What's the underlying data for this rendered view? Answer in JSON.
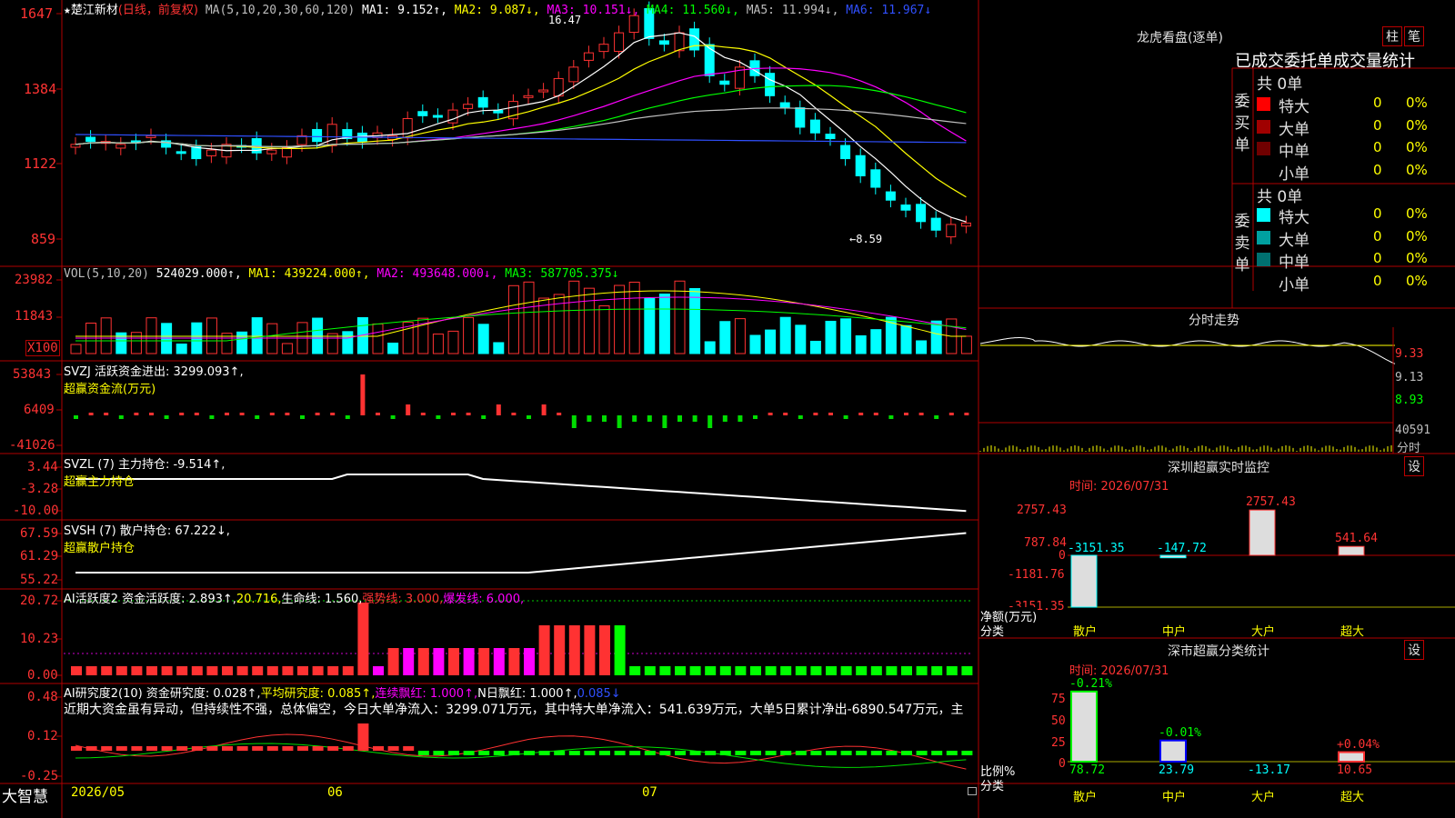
{
  "stock": {
    "star": "★",
    "name": "楚江新材",
    "period": "(日线，前复权)"
  },
  "kline": {
    "ma_label": "MA(5,10,20,30,60,120)",
    "ma1": "MA1: 9.152↑,",
    "ma2": "MA2: 9.087↓,",
    "ma3": "MA3: 10.151↓,",
    "ma4": "MA4: 11.560↓,",
    "ma5": "MA5: 11.994↓,",
    "ma6": "MA6: 11.967↓",
    "y_ticks": [
      "1647",
      "1384",
      "1122",
      "859"
    ],
    "high_label": "16.47",
    "low_label": "←8.59"
  },
  "volume": {
    "label": "VOL(5,10,20)",
    "value": "524029.000↑,",
    "ma1": "MA1: 439224.000↑,",
    "ma2": "MA2: 493648.000↓,",
    "ma3": "MA3: 587705.375↓",
    "y_ticks": [
      "23982",
      "11843",
      "X100"
    ]
  },
  "svzj": {
    "label": "SVZJ  活跃资金进出: 3299.093↑,",
    "sub": "超赢资金流(万元)",
    "y_ticks": [
      "53843",
      "6409",
      "-41026"
    ]
  },
  "svzl": {
    "label": "SVZL (7) 主力持仓: -9.514↑,",
    "sub": "超赢主力持仓",
    "y_ticks": [
      "3.44",
      "-3.28",
      "-10.00"
    ]
  },
  "svsh": {
    "label": "SVSH (7) 散户持仓: 67.222↓,",
    "sub": "超赢散户持仓",
    "y_ticks": [
      "67.59",
      "61.29",
      "55.22"
    ]
  },
  "ai_active": {
    "label": "AI活跃度2 资金活跃度: 2.893↑,",
    "v2": "20.716,",
    "life": "生命线: 1.560,",
    "strong": "强势线: 3.000,",
    "burst": "爆发线: 6.000,",
    "y_ticks": [
      "20.72",
      "10.23",
      "0.00"
    ]
  },
  "ai_research": {
    "label": "AI研究度2(10) 资金研究度: 0.028↑,",
    "avg": "平均研究度: 0.085↑,",
    "lianxu": "连续飘红: 1.000↑,",
    "nday": "N日飘红: 1.000↑,",
    "last": "0.085↓",
    "comment": "近期大资金虽有异动，但持续性不强，总体偏空，今日大单净流入：3299.071万元，其中特大单净流入：541.639万元，大单5日累计净出-6890.547万元，主",
    "y_ticks": [
      "0.48",
      "0.12",
      "-0.25"
    ]
  },
  "footer": {
    "brand": "大智慧",
    "dates": [
      "2026/05",
      "06",
      "07"
    ]
  },
  "dragon": {
    "title": "龙虎看盘(逐单)",
    "btn1": "柱",
    "btn2": "笔",
    "subtitle": "已成交委托单成交量统计",
    "buy": {
      "side": "委买单",
      "total": "共 0单",
      "rows": [
        {
          "name": "特大",
          "val": "0",
          "pct": "0%",
          "color": "#ff0000"
        },
        {
          "name": "大单",
          "val": "0",
          "pct": "0%",
          "color": "#a00000"
        },
        {
          "name": "中单",
          "val": "0",
          "pct": "0%",
          "color": "#700000"
        },
        {
          "name": "小单",
          "val": "0",
          "pct": "0%",
          "color": "#000000"
        }
      ]
    },
    "sell": {
      "side": "委卖单",
      "total": "共 0单",
      "rows": [
        {
          "name": "特大",
          "val": "0",
          "pct": "0%",
          "color": "#00ffff"
        },
        {
          "name": "大单",
          "val": "0",
          "pct": "0%",
          "color": "#00a0a0"
        },
        {
          "name": "中单",
          "val": "0",
          "pct": "0%",
          "color": "#007070"
        },
        {
          "name": "小单",
          "val": "0",
          "pct": "0%",
          "color": "#000000"
        }
      ]
    }
  },
  "intraday": {
    "title": "分时走势",
    "y_ticks": [
      "9.33",
      "9.13",
      "8.93"
    ],
    "vol": "40591",
    "vol_unit": "分时"
  },
  "monitor": {
    "title": "深圳超赢实时监控",
    "btn": "设",
    "time": "时间: 2026/07/31",
    "y_ticks": [
      "2757.43",
      "787.84",
      "0",
      "-1181.76",
      "-3151.35"
    ],
    "axis_label1": "净额(万元)",
    "axis_label2": "分类",
    "bars": [
      {
        "cat": "散户",
        "value": "-3151.35"
      },
      {
        "cat": "中户",
        "value": "-147.72"
      },
      {
        "cat": "大户",
        "value": "2757.43"
      },
      {
        "cat": "超大",
        "value": "541.64"
      }
    ]
  },
  "classify": {
    "title": "深市超赢分类统计",
    "btn": "设",
    "time": "时间: 2026/07/31",
    "y_ticks": [
      "75",
      "50",
      "25",
      "0"
    ],
    "axis_label1": "比例%",
    "axis_label2": "分类",
    "bars": [
      {
        "cat": "散户",
        "value": "78.72",
        "chg": "-0.21%"
      },
      {
        "cat": "中户",
        "value": "23.79",
        "chg": "-0.01%"
      },
      {
        "cat": "大户",
        "value": "-13.17",
        "chg": ""
      },
      {
        "cat": "超大",
        "value": "10.65",
        "chg": "+0.04%"
      }
    ]
  },
  "colors": {
    "up": "#ff3232",
    "down": "#00ffff",
    "ma1": "#ffffff",
    "ma2": "#ffff00",
    "ma3": "#ff00ff",
    "ma4": "#00ff00",
    "ma5": "#c0c0c0",
    "ma6": "#3050ff",
    "grid": "#b00000"
  }
}
